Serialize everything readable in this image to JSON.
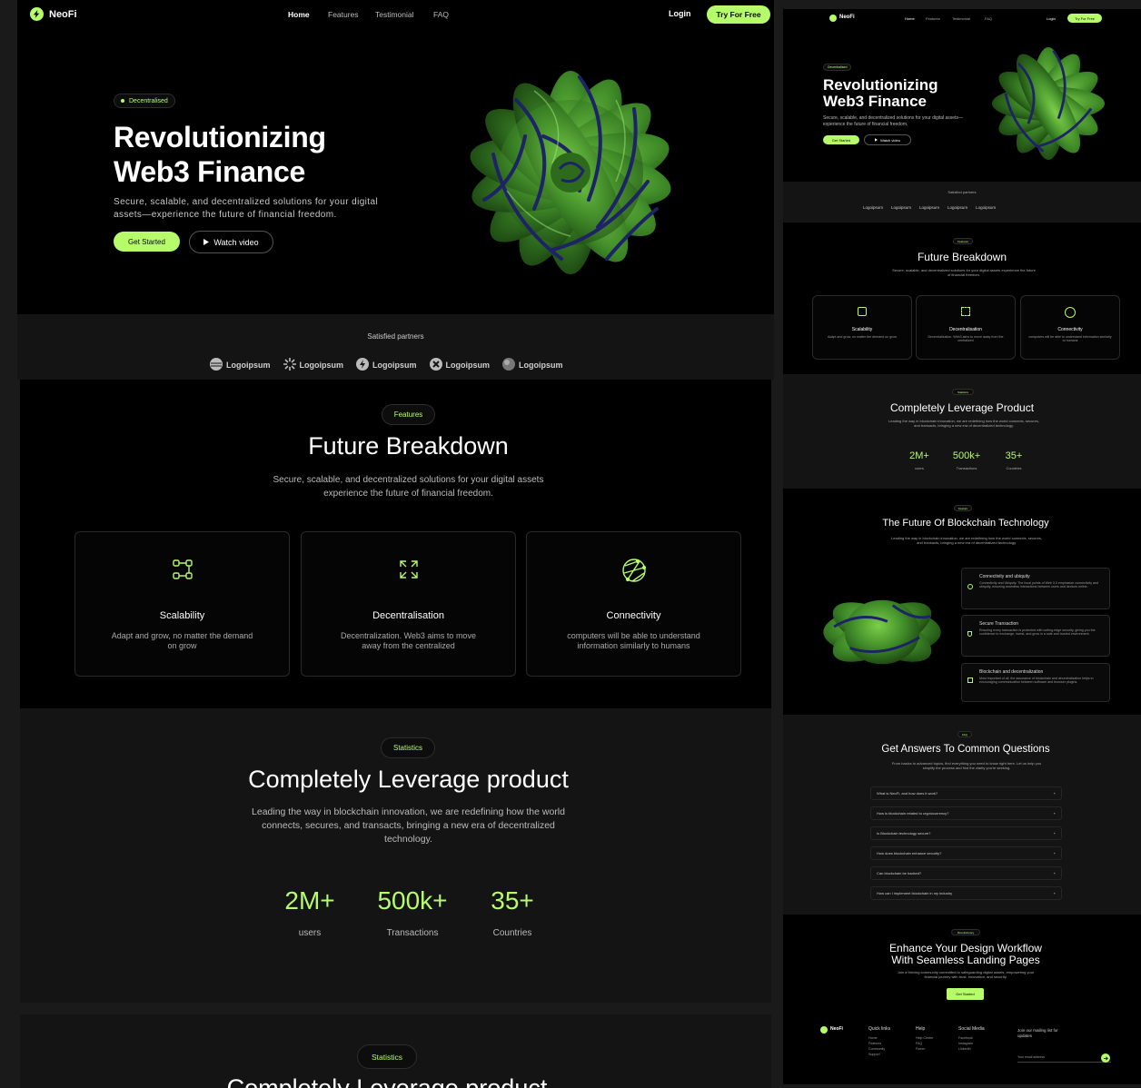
{
  "brand": {
    "name": "NeoFi",
    "accent": "#b6fb69"
  },
  "nav": {
    "items": [
      "Home",
      "Features",
      "Testimonial",
      "FAQ"
    ],
    "login": "Login",
    "cta": "Try For Free"
  },
  "hero": {
    "badge": "Decentralised",
    "title_line1": "Revolutionizing",
    "title_line2": "Web3 Finance",
    "subtitle_line1": "Secure, scalable, and decentralized solutions for your digital",
    "subtitle_line2": "assets—experience the future of financial freedom.",
    "primary": "Get Started",
    "secondary": "Watch video"
  },
  "partners": {
    "heading": "Satisfied partners",
    "logos": [
      "Logoipsum",
      "Logoipsum",
      "Logoipsum",
      "Logoipsum",
      "Logoipsum"
    ]
  },
  "features": {
    "badge": "Features",
    "title": "Future Breakdown",
    "subtitle_line1": "Secure, scalable, and decentralized solutions for your digital assets",
    "subtitle_line2": "experience the future of financial freedom.",
    "cards": [
      {
        "icon": "scalability-icon",
        "title": "Scalability",
        "desc_line1": "Adapt and grow, no matter the demand",
        "desc_line2": "on grow"
      },
      {
        "icon": "decentralisation-icon",
        "title": "Decentralisation",
        "desc_line1": "Decentralization. Web3 aims to move",
        "desc_line2": "away from the centralized"
      },
      {
        "icon": "connectivity-icon",
        "title": "Connectivity",
        "desc_line1": "computers will be able to understand",
        "desc_line2": "information similarly to humans"
      }
    ]
  },
  "stats": {
    "badge": "Statistics",
    "title": "Completely Leverage product",
    "subtitle_line1": "Leading the way in blockchain innovation, we are redefining how the world",
    "subtitle_line2": "connects, secures, and transacts, bringing a new era of decentralized",
    "subtitle_line3": "technology.",
    "items": [
      {
        "value": "2M+",
        "label": "users"
      },
      {
        "value": "500k+",
        "label": "Transactions"
      },
      {
        "value": "35+",
        "label": "Countries"
      }
    ]
  },
  "stats2": {
    "badge": "Statistics",
    "title": "Completely Leverage product"
  },
  "preview": {
    "hero_subtitle": "Secure, scalable, and decentralized solutions for your digital assets—experience the future of financial freedom.",
    "features_subtitle": "Secure, scalable, and decentralized solutions for your digital assets experience the future of financial freedom.",
    "card_descs": [
      "Adapt and grow, no matter the demand on grow",
      "Decentralization. Web3 aims to move away from the centralized",
      "computers will be able to understand information similarly to humans"
    ],
    "stats_title": "Completely Leverage Product",
    "stats_subtitle": "Leading the way in blockchain innovation, we are redefining how the world connects, secures, and transacts, bringing a new era of decentralized technology.",
    "tech": {
      "badge": "Feature",
      "title": "The Future Of Blockchain Technology",
      "subtitle": "Leading the way in blockchain innovation, we are redefining how the world connects, secures, and transacts, bringing a new era of decentralized technology.",
      "items": [
        {
          "title": "Connectivity and ubiquity",
          "desc": "Connectivity and Ubiquity. The focal points of Web 3.0 emphasize connectivity and ubiquity, ensuring seamless interactions between users and devices online."
        },
        {
          "title": "Secure Transaction",
          "desc": "Ensuring every transaction is protected with cutting-edge security, giving you the confidence to exchange, invest, and grow in a safe and trusted environment."
        },
        {
          "title": "Blockchain and decentralization",
          "desc": "Most important of all, the assurance of blockchain and decentralization helps in encouraging communication between software and browser plugins."
        }
      ]
    },
    "faq": {
      "badge": "FAQ",
      "title": "Get Answers To Common Questions",
      "subtitle": "From basics to advanced topics, find everything you need to know right here. Let us help you simplify the process and find the clarity you're seeking.",
      "items": [
        "What is NeoFi, and how does it work?",
        "How is blockchain related to cryptocurrency?",
        "Is Blockchain technology secure?",
        "How does blockchain enhance security?",
        "Can blockchain be hacked?",
        "How can I implement blockchain in my industry"
      ]
    },
    "cta": {
      "badge": "Revolutionary",
      "title_line1": "Enhance Your Design Workflow",
      "title_line2": "With Seamless Landing Pages",
      "subtitle": "Join a thriving community committed to safeguarding digital assets, empowering your financial journey with trust, innovation, and security.",
      "button": "Get Started"
    },
    "footer": {
      "cols": [
        {
          "title": "Quick links",
          "items": [
            "Home",
            "Features",
            "Community",
            "Support"
          ]
        },
        {
          "title": "Help",
          "items": [
            "Help Centre",
            "FAQ",
            "Forum"
          ]
        },
        {
          "title": "Social Media",
          "items": [
            "Facebook",
            "Instagram",
            "LinkedIn"
          ]
        }
      ],
      "mailing": "Join our mailing list for updates",
      "email_placeholder": "Your email address"
    }
  }
}
